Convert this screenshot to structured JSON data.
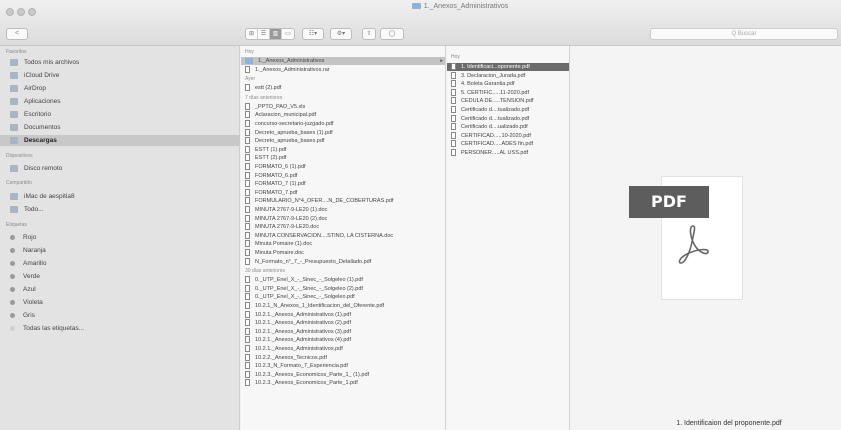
{
  "window": {
    "title": "1._Anexos_Administrativos"
  },
  "toolbar": {
    "back": "<",
    "search_placeholder": "Q Buscar"
  },
  "sidebar": {
    "favorites_header": "Favoritos",
    "favorites": [
      {
        "label": "Todos mis archivos",
        "icon": "all-files-icon"
      },
      {
        "label": "iCloud Drive",
        "icon": "cloud-icon"
      },
      {
        "label": "AirDrop",
        "icon": "airdrop-icon"
      },
      {
        "label": "Aplicaciones",
        "icon": "applications-icon"
      },
      {
        "label": "Escritorio",
        "icon": "desktop-icon"
      },
      {
        "label": "Documentos",
        "icon": "documents-icon"
      },
      {
        "label": "Descargas",
        "icon": "downloads-icon",
        "selected": true
      }
    ],
    "devices_header": "Dispositivos",
    "devices": [
      {
        "label": "Disco remoto",
        "icon": "disk-icon"
      }
    ],
    "shared_header": "Compartido",
    "shared": [
      {
        "label": "iMac de aespitia8",
        "icon": "imac-icon"
      },
      {
        "label": "Todo...",
        "icon": "network-icon"
      }
    ],
    "tags_header": "Etiquetas",
    "tags": [
      {
        "label": "Rojo",
        "color": "#9a9a9a"
      },
      {
        "label": "Naranja",
        "color": "#9a9a9a"
      },
      {
        "label": "Amarillo",
        "color": "#9a9a9a"
      },
      {
        "label": "Verde",
        "color": "#9a9a9a"
      },
      {
        "label": "Azul",
        "color": "#9a9a9a"
      },
      {
        "label": "Violeta",
        "color": "#9a9a9a"
      },
      {
        "label": "Gris",
        "color": "#9a9a9a"
      },
      {
        "label": "Todas las etiquetas...",
        "color": "#cfcfcf"
      }
    ]
  },
  "column1": {
    "group_hoy": "Hoy",
    "hoy": [
      {
        "name": "1._Anexos_Administrativos",
        "kind": "folder",
        "selected": true
      },
      {
        "name": "1._Anexos_Administrativos.rar",
        "kind": "file"
      }
    ],
    "group_ayer": "Ayer",
    "ayer": [
      {
        "name": "estt (2).pdf",
        "kind": "file"
      }
    ],
    "group_7dias": "7 días anteriores",
    "siete_dias": [
      {
        "name": "_PPTO_PAO_V5.xls",
        "kind": "file"
      },
      {
        "name": "Aclaracion_municipal.pdf",
        "kind": "file"
      },
      {
        "name": "concurso-secretario-juzgado.pdf",
        "kind": "file"
      },
      {
        "name": "Decreto_aprueba_bases (1).pdf",
        "kind": "file"
      },
      {
        "name": "Decreto_aprueba_bases.pdf",
        "kind": "file"
      },
      {
        "name": "ESTT (1).pdf",
        "kind": "file"
      },
      {
        "name": "ESTT (2).pdf",
        "kind": "file"
      },
      {
        "name": "FORMATO_6 (1).pdf",
        "kind": "file"
      },
      {
        "name": "FORMATO_6.pdf",
        "kind": "file"
      },
      {
        "name": "FORMATO_7 (1).pdf",
        "kind": "file"
      },
      {
        "name": "FORMATO_7.pdf",
        "kind": "file"
      },
      {
        "name": "FORMULARIO_N°4_OFER....N_DE_COBERTURAS.pdf",
        "kind": "file"
      },
      {
        "name": "MINUTA 2767-9-LE20 (1).doc",
        "kind": "file"
      },
      {
        "name": "MINUTA 2767-9-LE20 (2).doc",
        "kind": "file"
      },
      {
        "name": "MINUTA 2767-9-LE20.doc",
        "kind": "file"
      },
      {
        "name": "MINUTA CONSERVACION....STINO, LA CISTERNA.doc",
        "kind": "file"
      },
      {
        "name": "Minuta Pomaire (1).doc",
        "kind": "file"
      },
      {
        "name": "Minuta Pomaire.doc",
        "kind": "file"
      },
      {
        "name": "N_Formato_n°_7_-_Presupuesto_Detallado.pdf",
        "kind": "file"
      }
    ],
    "group_30dias": "30 días anteriores",
    "treinta_dias": [
      {
        "name": "0._UTP_Enel_X_-_Sinec_-_Solgeleo (1).pdf",
        "kind": "file"
      },
      {
        "name": "0._UTP_Enel_X_-_Sinec_-_Solgeleo (2).pdf",
        "kind": "file"
      },
      {
        "name": "0._UTP_Enel_X_-_Sinec_-_Solgeleo.pdf",
        "kind": "file"
      },
      {
        "name": "10.2.1_N_Anexos_1_Identificacion_del_Oferente.pdf",
        "kind": "file"
      },
      {
        "name": "10.2.1._Anexos_Administrativos (1).pdf",
        "kind": "file"
      },
      {
        "name": "10.2.1._Anexos_Administrativos (2).pdf",
        "kind": "file"
      },
      {
        "name": "10.2.1._Anexos_Administrativos (3).pdf",
        "kind": "file"
      },
      {
        "name": "10.2.1._Anexos_Administrativos (4).pdf",
        "kind": "file"
      },
      {
        "name": "10.2.1._Anexos_Administrativos.pdf",
        "kind": "file"
      },
      {
        "name": "10.2.2._Anexos_Tecnicos.pdf",
        "kind": "file"
      },
      {
        "name": "10.2.3_N_Formato_7_Experiencia.pdf",
        "kind": "file"
      },
      {
        "name": "10.2.3._Anexos_Economicos_Parte_1_ (1).pdf",
        "kind": "file"
      },
      {
        "name": "10.2.3._Anexos_Economicos_Parte_1.pdf",
        "kind": "file"
      }
    ]
  },
  "column2": {
    "group_hoy": "Hoy",
    "files": [
      {
        "name": "1. Identificaci...oponente.pdf",
        "selected": true
      },
      {
        "name": "3. Declaracion_Jurada.pdf"
      },
      {
        "name": "4. Boleta Garantia.pdf"
      },
      {
        "name": "5. CERTIFIC.....11-2020.pdf"
      },
      {
        "name": "CEDULA DE.....TENSION.pdf"
      },
      {
        "name": "Certificado d....tualizado.pdf"
      },
      {
        "name": "Certificado d....tualizado.pdf"
      },
      {
        "name": "Certificado d....ualizado.pdf"
      },
      {
        "name": "CERTIFICAD.....10-2020.pdf"
      },
      {
        "name": "CERTIFICAD.....ADES fin.pdf"
      },
      {
        "name": "PERSONER.....AL USS.pdf"
      }
    ]
  },
  "preview": {
    "badge": "PDF",
    "filename": "1. Identificaion del proponente.pdf"
  }
}
